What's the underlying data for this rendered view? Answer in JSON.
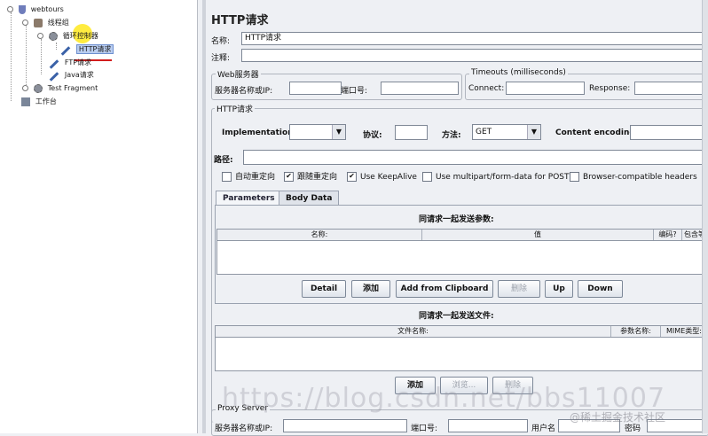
{
  "tree": {
    "items": [
      {
        "label": "webtours",
        "icon": "test-plan-icon"
      },
      {
        "label": "线程组",
        "icon": "thread-group-icon"
      },
      {
        "label": "循环控制器",
        "icon": "loop-controller-icon"
      },
      {
        "label": "HTTP请求",
        "icon": "http-sampler-icon"
      },
      {
        "label": "FTP请求",
        "icon": "ftp-sampler-icon"
      },
      {
        "label": "Java请求",
        "icon": "java-sampler-icon"
      },
      {
        "label": "Test Fragment",
        "icon": "test-fragment-icon"
      },
      {
        "label": "工作台",
        "icon": "workbench-icon"
      }
    ]
  },
  "panel": {
    "title": "HTTP请求",
    "name_label": "名称:",
    "name_value": "HTTP请求",
    "comment_label": "注释:",
    "comment_value": "",
    "web_server": {
      "legend": "Web服务器",
      "server_label": "服务器名称或IP:",
      "server_value": "",
      "port_label": "端口号:",
      "port_value": ""
    },
    "timeouts": {
      "legend": "Timeouts (milliseconds)",
      "connect_label": "Connect:",
      "connect_value": "",
      "response_label": "Response:",
      "response_value": ""
    },
    "http_request": {
      "legend": "HTTP请求",
      "implementation_label": "Implementation:",
      "implementation_value": "",
      "protocol_label": "协议:",
      "protocol_value": "",
      "method_label": "方法:",
      "method_value": "GET",
      "encoding_label": "Content encoding:",
      "encoding_value": "",
      "path_label": "路径:",
      "path_value": ""
    },
    "checkboxes": [
      {
        "label": "自动重定向",
        "checked": false
      },
      {
        "label": "跟随重定向",
        "checked": true
      },
      {
        "label": "Use KeepAlive",
        "checked": true
      },
      {
        "label": "Use multipart/form-data for POST",
        "checked": false
      },
      {
        "label": "Browser-compatible headers",
        "checked": false
      }
    ],
    "tabs": [
      {
        "label": "Parameters",
        "active": true
      },
      {
        "label": "Body Data",
        "active": false
      }
    ],
    "params": {
      "caption": "同请求一起发送参数:",
      "columns": [
        "名称:",
        "值",
        "编码?",
        "包含等于?"
      ],
      "buttons": {
        "detail": "Detail",
        "add": "添加",
        "add_clipboard": "Add from Clipboard",
        "delete": "删除",
        "up": "Up",
        "down": "Down"
      }
    },
    "files": {
      "caption": "同请求一起发送文件:",
      "columns": [
        "文件名称:",
        "参数名称:",
        "MIME类型:"
      ],
      "buttons": {
        "add": "添加",
        "browse": "浏览...",
        "delete": "删除"
      }
    },
    "proxy": {
      "legend": "Proxy Server",
      "server_label": "服务器名称或IP:",
      "port_label": "端口号:",
      "user_label": "用户名",
      "password_label": "密码"
    }
  },
  "watermark": {
    "url": "https://blog.csdn.net/bbs11007",
    "credit": "@稀土掘金技术社区"
  }
}
